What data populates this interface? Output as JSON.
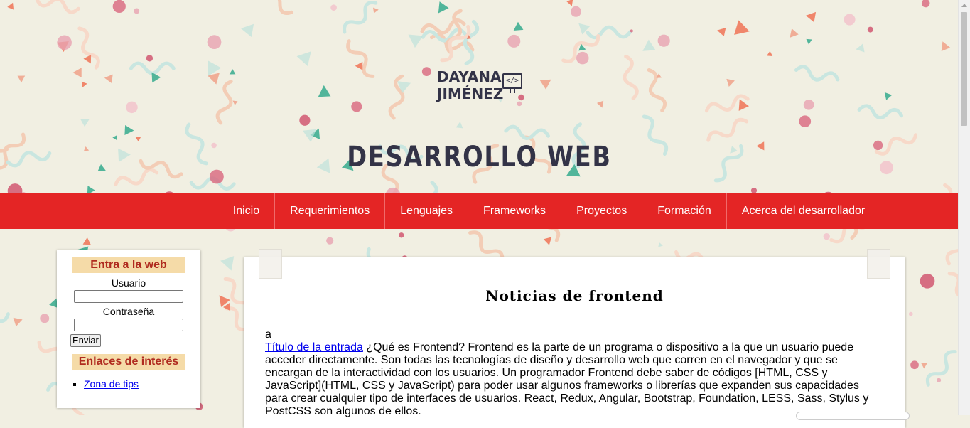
{
  "header": {
    "logo_line1": "DAYANA",
    "logo_line2": "JIMÉNEZ",
    "logo_icon_text": "</>",
    "site_title": "DESARROLLO WEB"
  },
  "nav": {
    "items": [
      {
        "label": "Inicio"
      },
      {
        "label": "Requerimientos"
      },
      {
        "label": "Lenguajes"
      },
      {
        "label": "Frameworks"
      },
      {
        "label": "Proyectos"
      },
      {
        "label": "Formación"
      },
      {
        "label": "Acerca del desarrollador"
      }
    ]
  },
  "sidebar": {
    "login_heading": "Entra a la web",
    "user_label": "Usuario",
    "user_value": "",
    "password_label": "Contraseña",
    "password_value": "",
    "submit_label": "Enviar",
    "links_heading": "Enlaces de interés",
    "links": [
      {
        "label": "Zona de tips"
      }
    ]
  },
  "main": {
    "title": "Noticias de frontend",
    "stray_text": "a",
    "entry_link": "Título de la entrada",
    "entry_text": " ¿Qué es Frontend? Frontend es la parte de un programa o dispositivo a la que un usuario puede acceder directamente. Son todas las tecnologías de diseño y desarrollo web que corren en el navegador y que se encargan de la interactividad con los usuarios. Un programador Frontend debe saber de códigos [HTML, CSS y JavaScript](HTML, CSS y JavaScript) para poder usar algunos frameworks o librerías que expanden sus capacidades para crear cualquier tipo de interfaces de usuarios. React, Redux, Angular, Bootstrap, Foundation, LESS, Sass, Stylus y PostCSS son algunos de ellos."
  },
  "colors": {
    "nav_bg": "#e42525",
    "title_text": "#333347",
    "heading_bg": "#f5dba8",
    "heading_text": "#b02b1f",
    "rule": "#3a6e8c"
  }
}
